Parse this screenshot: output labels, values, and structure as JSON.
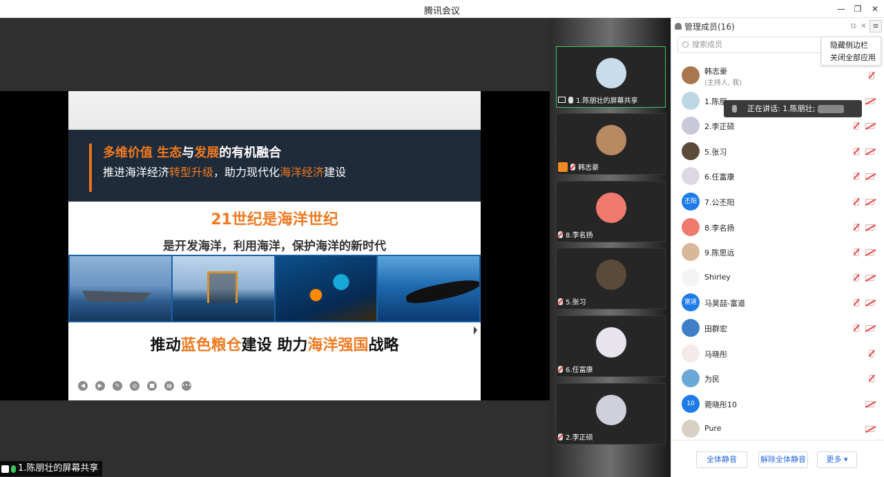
{
  "window": {
    "title": "腾讯会议",
    "minimize": "—",
    "restore": "❐",
    "close": "✕"
  },
  "slide": {
    "heading_parts": [
      "多维价值  ",
      "生态",
      "与",
      "发展",
      "的有机融合"
    ],
    "subheading_parts": [
      "推进海洋经济",
      "转型升级",
      "，助力现代化",
      "海洋经济",
      "建设"
    ],
    "big_title": "21世纪是海洋世纪",
    "subtitle": "是开发海洋，利用海洋，保护海洋的新时代",
    "bottom_parts": [
      "推动",
      "蓝色粮仓",
      "建设    助力",
      "海洋强国",
      "战略"
    ],
    "controls": [
      "◀",
      "▶",
      "✎",
      "◎",
      "■",
      "▤",
      "•••"
    ]
  },
  "share_label": "1.陈朋壮的屏幕共享",
  "tiles": [
    {
      "label": "1.陈朋壮的屏幕共享",
      "avatar_color": "#c9dceb",
      "active": true,
      "mic": "on",
      "sharing": true
    },
    {
      "label": "韩志豪",
      "avatar_color": "#b88a62",
      "active": false,
      "mic": "off",
      "host_badge": true
    },
    {
      "label": "8.李名扬",
      "avatar_color": "#f07a6e",
      "active": false,
      "mic": "off"
    },
    {
      "label": "5.张习",
      "avatar_color": "#5a4a3a",
      "active": false,
      "mic": "off"
    },
    {
      "label": "6.任富康",
      "avatar_color": "#e8e4ee",
      "active": false,
      "mic": "off"
    },
    {
      "label": "2.李正硕",
      "avatar_color": "#d0d0dc",
      "active": false,
      "mic": "off"
    }
  ],
  "panel": {
    "title": "管理成员(16)",
    "search_placeholder": "搜索成员",
    "menu": [
      "隐藏侧边栏",
      "关闭全部应用"
    ],
    "speaking_toast": "正在讲话: 1.陈朋壮;",
    "members": [
      {
        "name": "韩志豪",
        "role": "(主持人, 我)",
        "avatar_color": "#a9774f",
        "avatar_text": "",
        "mic": true,
        "cam": false
      },
      {
        "name": "1.陈朋",
        "role": "",
        "avatar_color": "#bcd6e4",
        "avatar_text": "",
        "mic": false,
        "cam": true
      },
      {
        "name": "2.李正硕",
        "role": "",
        "avatar_color": "#c8c8d8",
        "avatar_text": "",
        "mic": true,
        "cam": true
      },
      {
        "name": "5.张习",
        "role": "",
        "avatar_color": "#5a4a3a",
        "avatar_text": "",
        "mic": true,
        "cam": true
      },
      {
        "name": "6.任富康",
        "role": "",
        "avatar_color": "#dcd8e6",
        "avatar_text": "",
        "mic": true,
        "cam": true
      },
      {
        "name": "7.公丕阳",
        "role": "",
        "avatar_color": "#1e7be8",
        "avatar_text": "丕阳",
        "mic": true,
        "cam": true
      },
      {
        "name": "8.李名扬",
        "role": "",
        "avatar_color": "#f07a6e",
        "avatar_text": "",
        "mic": true,
        "cam": true
      },
      {
        "name": "9.陈思远",
        "role": "",
        "avatar_color": "#d9b89a",
        "avatar_text": "",
        "mic": true,
        "cam": true
      },
      {
        "name": "Shirley",
        "role": "",
        "avatar_color": "#f4f4f4",
        "avatar_text": "",
        "mic": true,
        "cam": true
      },
      {
        "name": "马昊喆-富道",
        "role": "",
        "avatar_color": "#1e7be8",
        "avatar_text": "富道",
        "mic": true,
        "cam": true
      },
      {
        "name": "田群宏",
        "role": "",
        "avatar_color": "#3f7fc8",
        "avatar_text": "",
        "mic": true,
        "cam": true
      },
      {
        "name": "马晓彤",
        "role": "",
        "avatar_color": "#f6e9e9",
        "avatar_text": "",
        "mic": true,
        "cam": false
      },
      {
        "name": "为民",
        "role": "",
        "avatar_color": "#6aa8d8",
        "avatar_text": "",
        "mic": true,
        "cam": false
      },
      {
        "name": "菀晓彤10",
        "role": "",
        "avatar_color": "#1e7be8",
        "avatar_text": "10",
        "mic": false,
        "cam": true
      },
      {
        "name": "Pure",
        "role": "",
        "avatar_color": "#d8d0c4",
        "avatar_text": "",
        "mic": false,
        "cam": true
      }
    ],
    "footer": {
      "mute_all": "全体静音",
      "unmute_all": "解除全体静音",
      "more": "更多 ▾"
    }
  },
  "colors": {
    "accent": "#2a6ae0",
    "orange": "#f07a22",
    "active_green": "#3ec45a",
    "muted_red": "#e04848"
  }
}
